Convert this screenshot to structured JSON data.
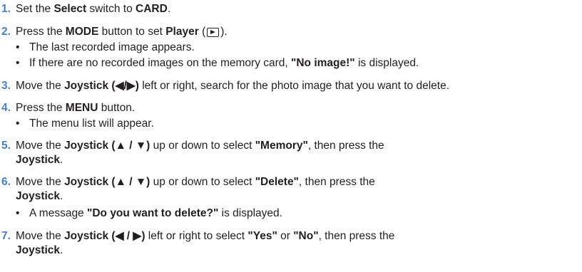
{
  "steps": [
    {
      "num": "1.",
      "a": "Set the ",
      "b1": "Select",
      "c": " switch to ",
      "b2": "CARD",
      "d": "."
    },
    {
      "num": "2.",
      "a": "Press the ",
      "b1": "MODE",
      "c": " button to set ",
      "b2": "Player",
      "d1": " (",
      "icon": "play-mode-icon",
      "d2": ")."
    },
    {
      "bullet1": "The last recorded image appears.",
      "bullet2_a": "If there are no recorded images on the memory card, ",
      "bullet2_b": "\"No image!\"",
      "bullet2_c": " is displayed."
    },
    {
      "num": "3.",
      "a": "Move the ",
      "b1": "Joystick (◀/▶)",
      "c": " left or right, search for the photo image that you want to delete."
    },
    {
      "num": "4.",
      "a": "Press the ",
      "b1": "MENU",
      "c": " button.",
      "bullet": "The menu list will appear."
    },
    {
      "num": "5.",
      "a": "Move the ",
      "b1": "Joystick (▲ / ▼)",
      "c": " up or down to select ",
      "b2": "\"Memory\"",
      "d": ", then press the",
      "line2": "Joystick",
      "line2_end": "."
    },
    {
      "num": "6.",
      "a": "Move the ",
      "b1": "Joystick (▲ / ▼)",
      "c": " up or down to select ",
      "b2": "\"Delete\"",
      "d": ", then press the",
      "line2": "Joystick",
      "line2_end": ".",
      "bullet_a": "A message ",
      "bullet_b": "\"Do you want to delete?\"",
      "bullet_c": " is displayed."
    },
    {
      "num": "7.",
      "a": "Move the ",
      "b1": "Joystick (◀ / ▶)",
      "c": " left or right to select ",
      "b2": "\"Yes\"",
      "c2": " or ",
      "b3": "\"No\"",
      "d": ", then press the",
      "line2": "Joystick",
      "line2_end": "."
    }
  ],
  "bullet_char": "•"
}
